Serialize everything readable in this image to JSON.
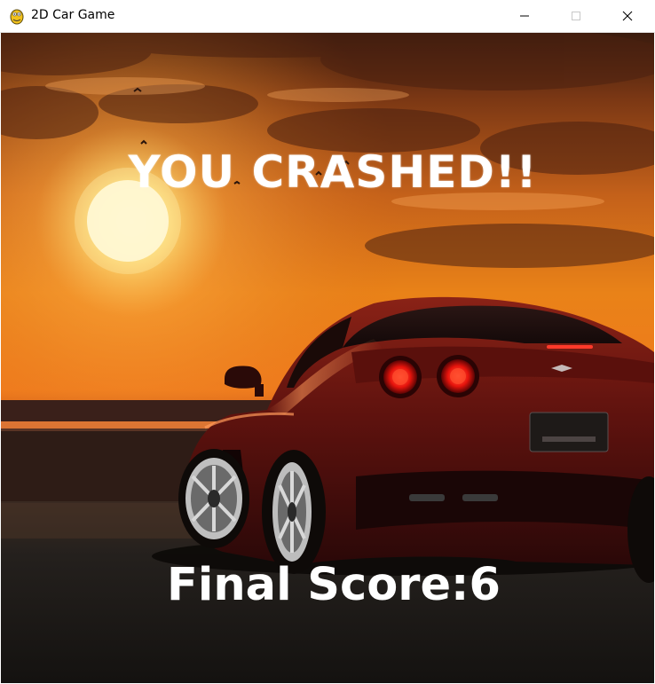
{
  "window": {
    "title": "2D Car Game",
    "icon": "pygame-snake-icon",
    "controls": [
      "minimize-icon",
      "maximize-icon",
      "close-icon"
    ]
  },
  "game": {
    "message": "YOU CRASHED!!",
    "score_label": "Final Score:",
    "score_value": "6"
  },
  "colors": {
    "sky_top": "#3b1a0c",
    "sky_glow": "#f28a1a",
    "sun": "#fff6c8",
    "ground": "#1c1612",
    "car_body": "#6a1410",
    "tail_light": "#ff2a1a",
    "text": "#ffffff"
  }
}
